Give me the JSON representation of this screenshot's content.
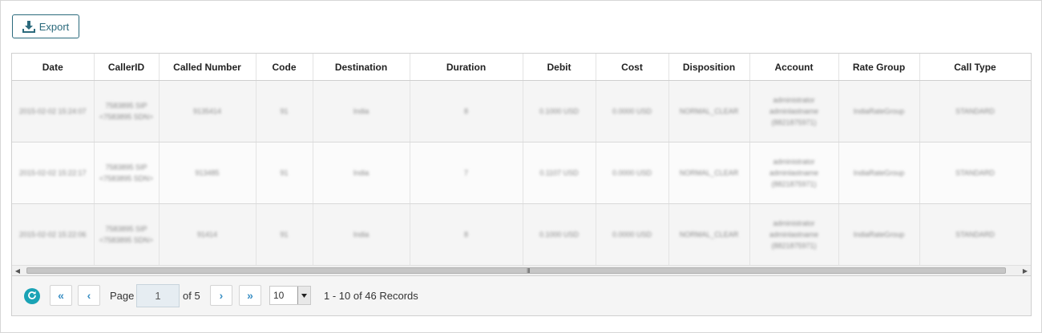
{
  "toolbar": {
    "export_label": "Export"
  },
  "table": {
    "columns": [
      "Date",
      "CallerID",
      "Called Number",
      "Code",
      "Destination",
      "Duration",
      "Debit",
      "Cost",
      "Disposition",
      "Account",
      "Rate Group",
      "Call Type"
    ],
    "rows": [
      [
        "2015-02-02 15:24:07",
        "7583895 SIP <7583895 SDN>",
        "9135414",
        "91",
        "India",
        "8",
        "0.1000 USD",
        "0.0000 USD",
        "NORMAL_CLEAR",
        "administrator adminlastname (8821875971)",
        "IndiaRateGroup",
        "STANDARD"
      ],
      [
        "2015-02-02 15:22:17",
        "7583895 SIP <7583895 SDN>",
        "913485",
        "91",
        "India",
        "7",
        "0.1107 USD",
        "0.0000 USD",
        "NORMAL_CLEAR",
        "administrator adminlastname (8821875971)",
        "IndiaRateGroup",
        "STANDARD"
      ],
      [
        "2015-02-02 15:22:06",
        "7583895 SIP <7583895 SDN>",
        "91414",
        "91",
        "India",
        "8",
        "0.1000 USD",
        "0.0000 USD",
        "NORMAL_CLEAR",
        "administrator adminlastname (8821875971)",
        "IndiaRateGroup",
        "STANDARD"
      ]
    ]
  },
  "scrollbar": {
    "grip": "III"
  },
  "pager": {
    "first": "«",
    "prev": "‹",
    "next": "›",
    "last": "»",
    "page_label": "Page",
    "page_value": "1",
    "of_label": "of 5",
    "page_size": "10",
    "records": "1 - 10 of 46 Records"
  },
  "colors": {
    "accent": "#2b6a7c",
    "refresh": "#1aa3b5",
    "pager_link": "#3a8fc4"
  }
}
